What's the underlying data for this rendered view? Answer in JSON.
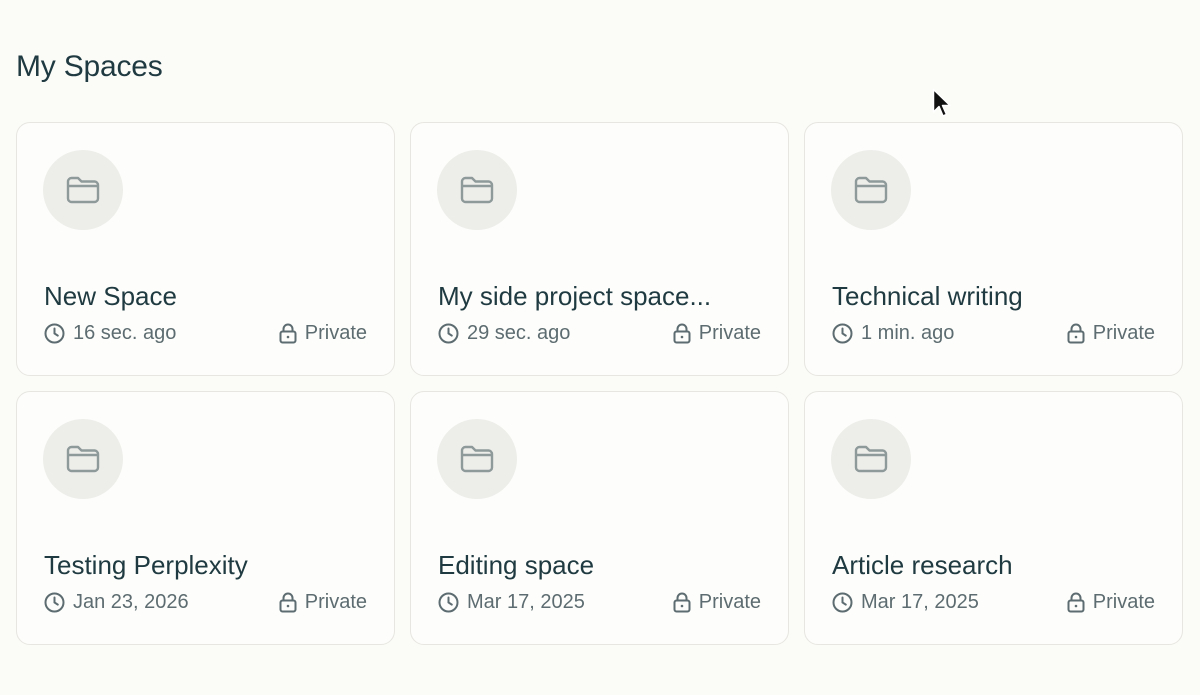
{
  "page": {
    "title": "My Spaces"
  },
  "spaces": [
    {
      "title": "New Space",
      "updated": "16 sec. ago",
      "visibility": "Private"
    },
    {
      "title": "My side project space...",
      "updated": "29 sec. ago",
      "visibility": "Private"
    },
    {
      "title": "Technical writing",
      "updated": "1 min. ago",
      "visibility": "Private"
    },
    {
      "title": "Testing Perplexity",
      "updated": "Jan 23, 2026",
      "visibility": "Private"
    },
    {
      "title": "Editing space",
      "updated": "Mar 17, 2025",
      "visibility": "Private"
    },
    {
      "title": "Article research",
      "updated": "Mar 17, 2025",
      "visibility": "Private"
    }
  ],
  "icons": {
    "card_icon": "folder-icon",
    "time_icon": "clock-icon",
    "visibility_icon": "lock-icon"
  },
  "colors": {
    "background": "#fbfbf8",
    "text": "#1f3a40",
    "muted": "#5d6c70",
    "card_border": "#e7e6e1",
    "icon_circle": "#ededea"
  }
}
